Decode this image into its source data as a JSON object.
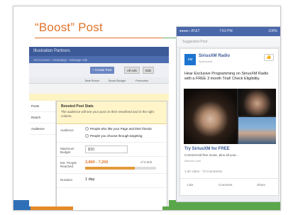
{
  "slide": {
    "title": "“Boost” Post",
    "colors": {
      "title": "#e0742a",
      "band_blue": "#2f6fb7",
      "band_orange": "#e58a2a",
      "band_green": "#5aa64a"
    }
  },
  "left_screenshot": {
    "app_title": "Illustration Partners",
    "breadcrumb": "Ad Account › Campaign › Manage Ads",
    "create_button": "+ Create Post",
    "filter_buttons": [
      "All Ads",
      "Edit"
    ],
    "columns": [
      "Total Reach",
      "Boost Budget",
      "Promotion"
    ],
    "sidebar_items": [
      "Posts",
      "Reach",
      "Audience"
    ],
    "popup": {
      "heading": "Boosted Post Stats",
      "description": "The audience will see your post on their newsfeed and in the right column.",
      "audience_label": "Audience",
      "audience_options": [
        "People who like your Page and their friends",
        "People you choose through targeting"
      ],
      "budget_label": "Maximum Budget",
      "budget_value": "$30",
      "reach_label": "Est. People Reached",
      "reach_value": "3,800 - 7,200",
      "reach_max": "of 9,600",
      "duration_label": "Duration",
      "duration_value": "1 day"
    }
  },
  "phone": {
    "carrier": "●●●●○ AT&T",
    "time": "7:53 PM",
    "battery": "100%",
    "section_label": "Suggested Post",
    "post": {
      "page_name": "SiriusXM Radio",
      "sponsored": "Sponsored",
      "text": "Hear Exclusive Programming on SiriusXM Radio with a FREE 3 month Trial! Check Eligibility.",
      "cta_title": "Try SiriusXM for FREE",
      "cta_text": "Commercial-free music, plus all your...",
      "cta_domain": "siriusxm.com",
      "likes": "1.2K Likes · 72 Comments",
      "actions": [
        "Like",
        "Comment",
        "Share"
      ]
    }
  }
}
